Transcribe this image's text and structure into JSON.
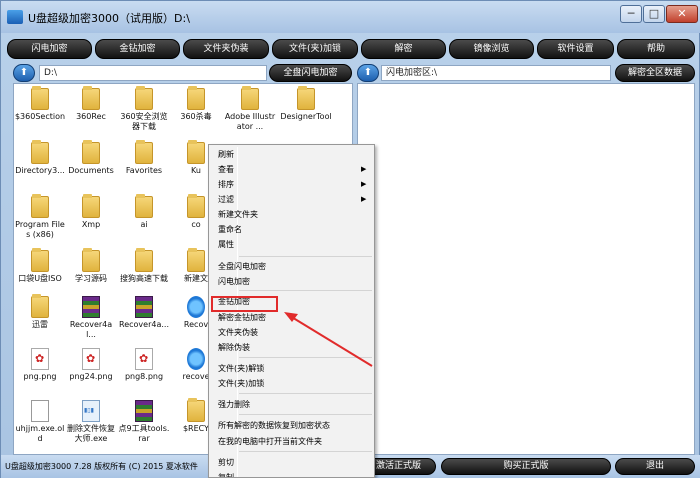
{
  "window": {
    "title": "U盘超级加密3000（试用版）D:\\",
    "controls": [
      "─",
      "□",
      "✕"
    ]
  },
  "toolbar": {
    "buttons": [
      "闪电加密",
      "金钻加密",
      "文件夹伪装",
      "文件(夹)加锁",
      "解密",
      "镜像浏览",
      "软件设置",
      "帮助"
    ]
  },
  "left_path": {
    "up_icon": "⬆",
    "value": "D:\\",
    "action_button": "全盘闪电加密"
  },
  "right_path": {
    "up_icon": "⬆",
    "value": "闪电加密区:\\",
    "action_button": "解密全区数据"
  },
  "files": [
    {
      "name": "$360Section",
      "type": "folder"
    },
    {
      "name": "360Rec",
      "type": "folder"
    },
    {
      "name": "360安全浏览器下载",
      "type": "folder"
    },
    {
      "name": "360杀毒",
      "type": "folder"
    },
    {
      "name": "Adobe Illustrator ...",
      "type": "folder"
    },
    {
      "name": "DesignerTool",
      "type": "folder"
    },
    {
      "name": "Directory3...",
      "type": "folder"
    },
    {
      "name": "Documents",
      "type": "folder"
    },
    {
      "name": "Favorites",
      "type": "folder"
    },
    {
      "name": "Ku",
      "type": "folder"
    },
    {
      "name": "Program Files (x86)",
      "type": "folder"
    },
    {
      "name": "Xmp",
      "type": "folder"
    },
    {
      "name": "ai",
      "type": "folder"
    },
    {
      "name": "co",
      "type": "folder"
    },
    {
      "name": "口袋U盘ISO",
      "type": "folder"
    },
    {
      "name": "学习源码",
      "type": "folder"
    },
    {
      "name": "搜狗高速下载",
      "type": "folder"
    },
    {
      "name": "新建文",
      "type": "folder"
    },
    {
      "name": "迅雷",
      "type": "folder"
    },
    {
      "name": "Recover4al...",
      "type": "archive"
    },
    {
      "name": "Recover4a...",
      "type": "archive"
    },
    {
      "name": "Recov",
      "type": "bluecirc"
    },
    {
      "name": "png.png",
      "type": "png"
    },
    {
      "name": "png24.png",
      "type": "png"
    },
    {
      "name": "png8.png",
      "type": "png"
    },
    {
      "name": "recove",
      "type": "bluecirc"
    },
    {
      "name": "uhjjm.exe.old",
      "type": "doc"
    },
    {
      "name": "删除文件恢复大师.exe",
      "type": "exe"
    },
    {
      "name": "点9工具tools.rar",
      "type": "archive"
    },
    {
      "name": "$RECY",
      "type": "folder"
    }
  ],
  "context_menu": {
    "items": [
      {
        "label": "刷新",
        "submenu": false
      },
      {
        "label": "查看",
        "submenu": true
      },
      {
        "label": "排序",
        "submenu": true
      },
      {
        "label": "过滤",
        "submenu": true
      },
      {
        "label": "新建文件夹",
        "submenu": false
      },
      {
        "label": "重命名",
        "submenu": false
      },
      {
        "label": "属性",
        "submenu": false
      },
      {
        "label": "全盘闪电加密",
        "submenu": false
      },
      {
        "label": "闪电加密",
        "submenu": false
      },
      {
        "label": "金钻加密",
        "submenu": false,
        "highlighted": true
      },
      {
        "label": "解密金钻加密",
        "submenu": false
      },
      {
        "label": "文件夹伪装",
        "submenu": false
      },
      {
        "label": "解除伪装",
        "submenu": false
      },
      {
        "label": "文件(夹)解锁",
        "submenu": false
      },
      {
        "label": "文件(夹)加锁",
        "submenu": false
      },
      {
        "label": "强力删除",
        "submenu": false
      },
      {
        "label": "所有解密的数据恢复到加密状态",
        "submenu": false
      },
      {
        "label": "在我的电脑中打开当前文件夹",
        "submenu": false
      },
      {
        "label": "剪切",
        "submenu": false
      },
      {
        "label": "复制",
        "submenu": false
      }
    ],
    "submenu_arrow": "▶"
  },
  "statusbar": {
    "text": "U盘超级加密3000 7.28 版权所有 (C) 2015 夏冰软件",
    "buttons": [
      "激活正式版",
      "购买正式版",
      "退出"
    ]
  },
  "colors": {
    "highlight_box": "#e12b2b",
    "button_dark": "#111111",
    "title_bar": "#b9d1ea"
  }
}
